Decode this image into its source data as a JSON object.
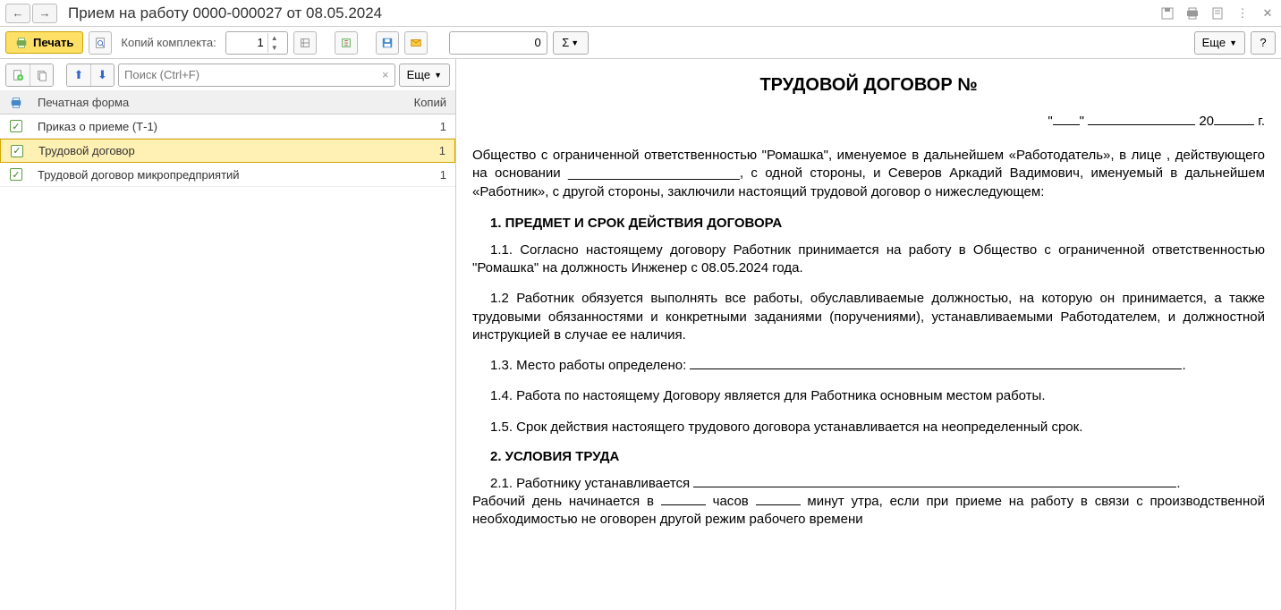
{
  "title": "Прием на работу 0000-000027 от 08.05.2024",
  "toolbar": {
    "print_label": "Печать",
    "copies_label": "Копий комплекта:",
    "copies_value": "1",
    "counter_value": "0",
    "sigma": "Σ",
    "more_label": "Еще",
    "help_label": "?"
  },
  "left": {
    "search_placeholder": "Поиск (Ctrl+F)",
    "more_label": "Еще",
    "columns": {
      "name": "Печатная форма",
      "copies": "Копий"
    },
    "rows": [
      {
        "name": "Приказ о приеме (Т-1)",
        "copies": "1",
        "selected": false
      },
      {
        "name": "Трудовой договор",
        "copies": "1",
        "selected": true
      },
      {
        "name": "Трудовой договор микропредприятий",
        "copies": "1",
        "selected": false
      }
    ]
  },
  "doc": {
    "title": "ТРУДОВОЙ ДОГОВОР №",
    "date_prefix": "\"",
    "date_mid": "\"",
    "date_year": "20",
    "date_suffix": "г.",
    "intro": "Общество с ограниченной ответственностью \"Ромашка\", именуемое в дальнейшем «Работодатель», в лице , действующего на основании _______________________, с одной стороны, и Северов Аркадий Вадимович, именуемый в дальнейшем «Работник», с другой стороны, заключили настоящий трудовой договор о нижеследующем:",
    "s1": "1. ПРЕДМЕТ И СРОК ДЕЙСТВИЯ ДОГОВОРА",
    "c11": "1.1. Согласно настоящему договору Работник принимается на работу в Общество с ограниченной ответственностью \"Ромашка\" на должность Инженер с 08.05.2024 года.",
    "c12": "1.2 Работник обязуется выполнять все работы, обуславливаемые должностью, на которую он принимается, а также трудовыми обязанностями и конкретными заданиями (поручениями), устанавливаемыми Работодателем, и должностной инструкцией в случае ее наличия.",
    "c13_pre": "1.3. Место работы определено: ",
    "c14": "1.4. Работа по настоящему Договору является для Работника основным местом работы.",
    "c15": "1.5. Срок действия настоящего трудового договора устанавливается на неопределенный срок.",
    "s2": "2. УСЛОВИЯ ТРУДА",
    "c21_pre": "2.1. Работнику устанавливается ",
    "c21_line2a": "Рабочий день начинается в ",
    "c21_line2b": " часов ",
    "c21_line2c": " минут утра, если при приеме на работу в связи с производственной необходимостью не оговорен другой режим рабочего времени"
  }
}
